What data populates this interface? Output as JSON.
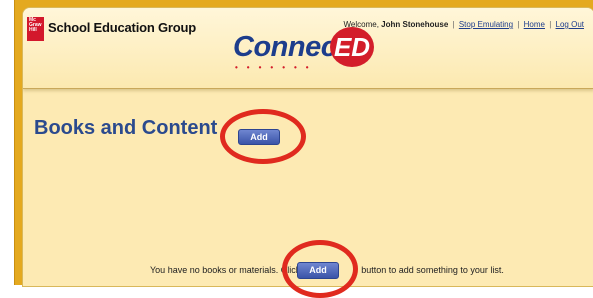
{
  "header": {
    "org_logo_text": "Mc\nGraw\nHill",
    "org_name": "School Education Group",
    "product_logo": {
      "word": "Connect",
      "badge": "ED"
    },
    "user": {
      "welcome": "Welcome,",
      "name": "John Stonehouse",
      "links": [
        "Stop Emulating",
        "Home",
        "Log Out"
      ]
    }
  },
  "main": {
    "title": "Books and Content",
    "add_label": "Add",
    "empty_message_before": "You have no books or materials. Click the",
    "empty_message_after": "button to add something to your list.",
    "empty_add_label": "Add"
  },
  "colors": {
    "accent": "#2b4a8e",
    "annotation": "#e02a1e",
    "background": "#fdeab3",
    "frame": "#e4a91f"
  }
}
